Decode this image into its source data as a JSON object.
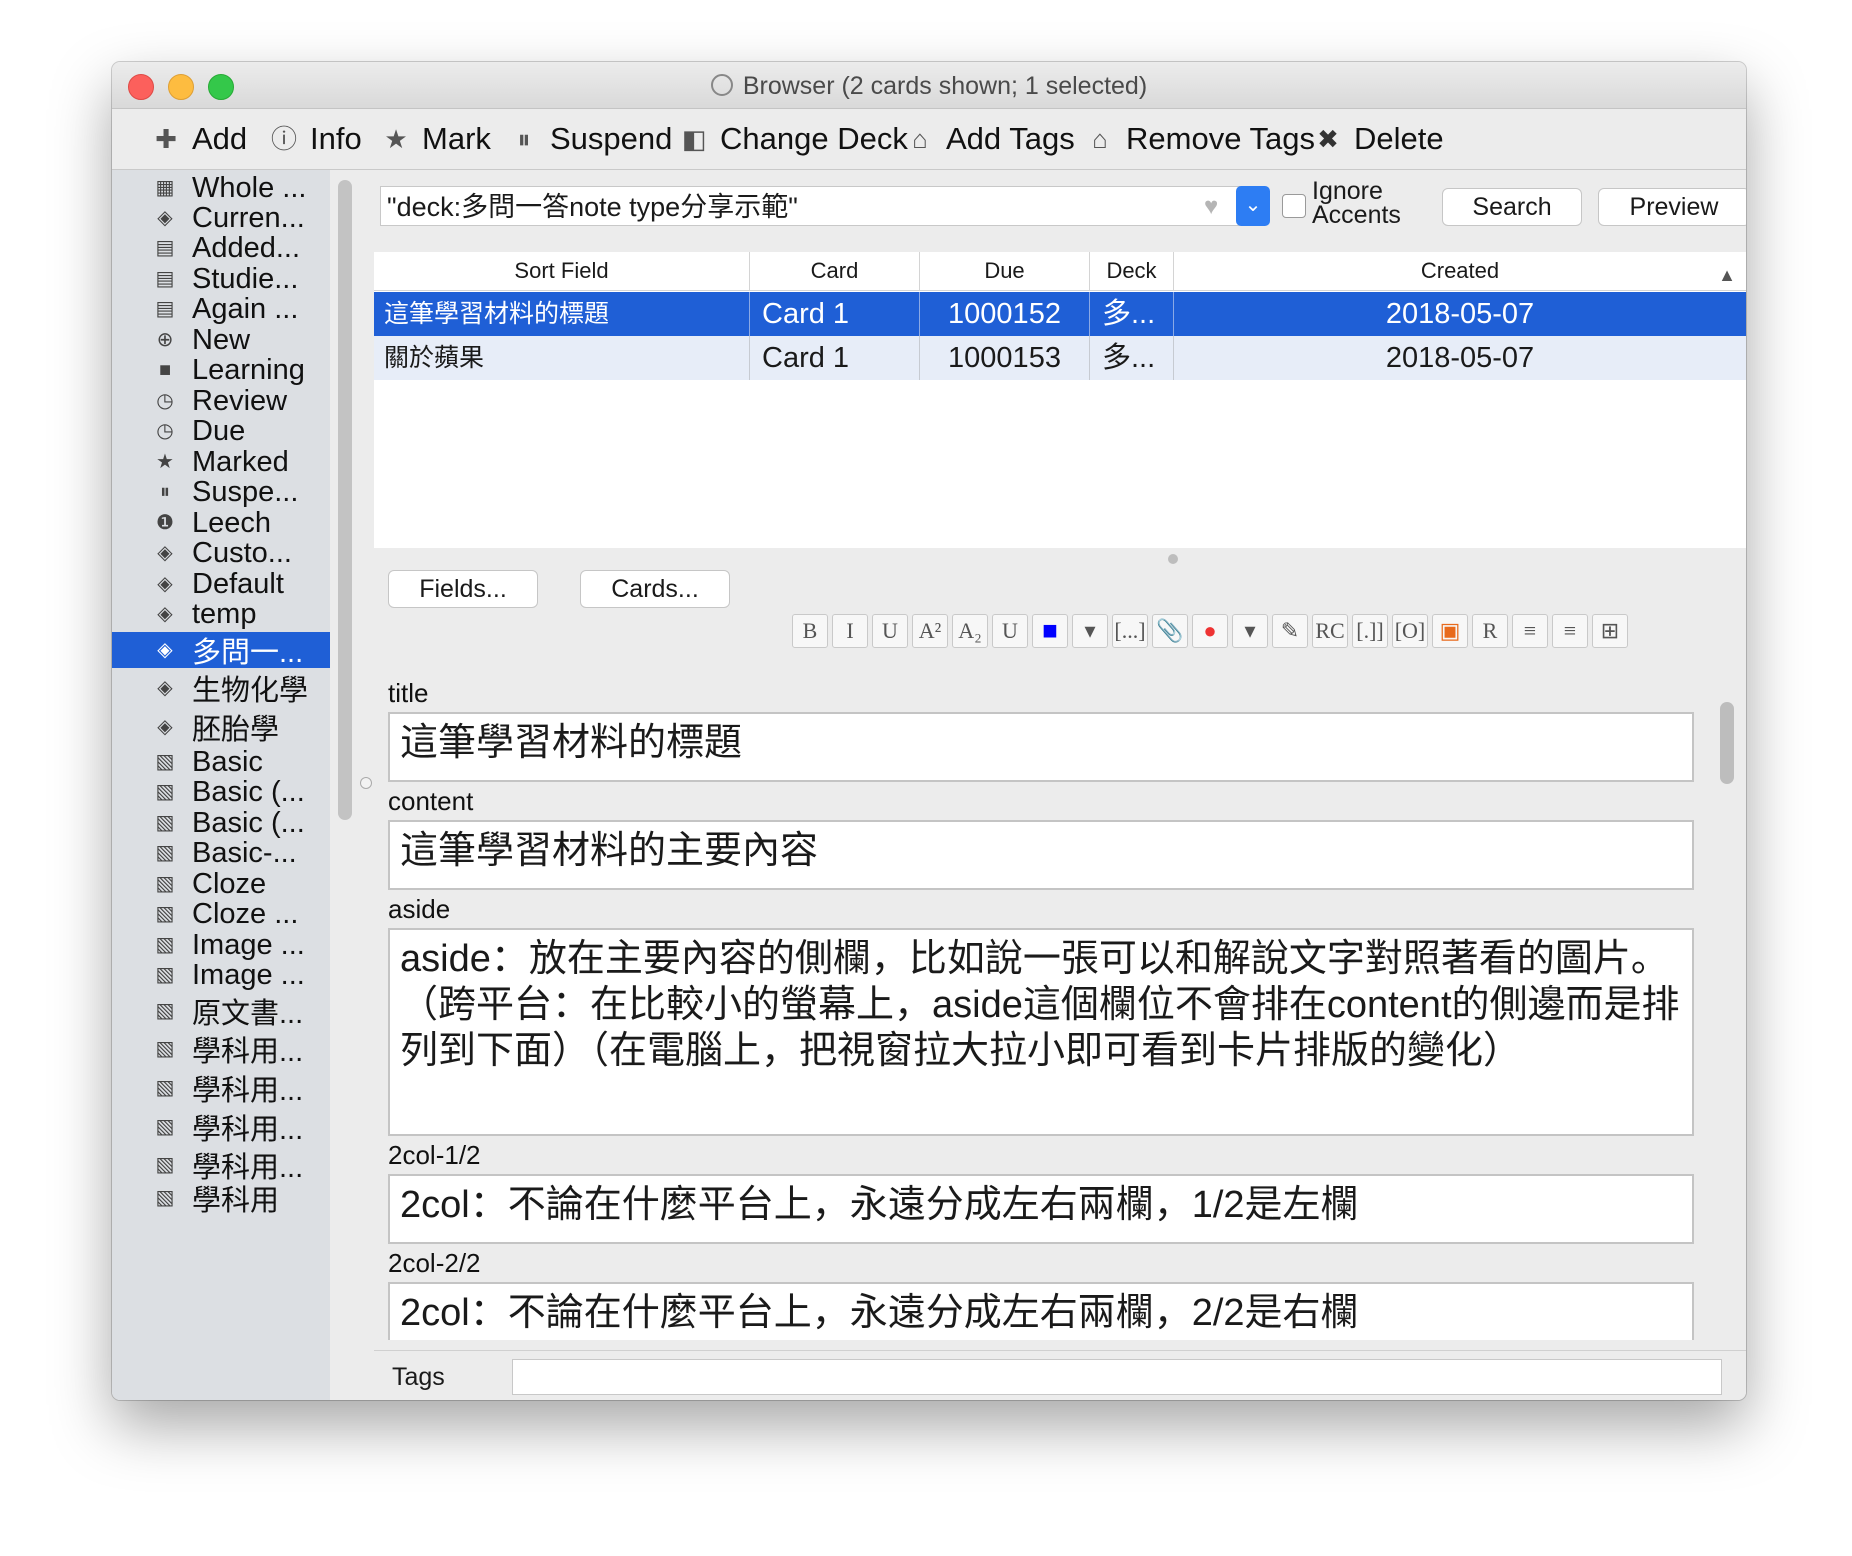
{
  "window": {
    "title": "Browser (2 cards shown; 1 selected)"
  },
  "toolbar": {
    "add": "Add",
    "info": "Info",
    "mark": "Mark",
    "suspend": "Suspend",
    "change_deck": "Change Deck",
    "add_tags": "Add Tags",
    "remove_tags": "Remove Tags",
    "delete": "Delete"
  },
  "sidebar": {
    "items": [
      {
        "label": "Whole ...",
        "icon": "collection-icon"
      },
      {
        "label": "Curren...",
        "icon": "deck-icon"
      },
      {
        "label": "Added...",
        "icon": "calendar-icon"
      },
      {
        "label": "Studie...",
        "icon": "calendar-icon"
      },
      {
        "label": "Again ...",
        "icon": "calendar-icon"
      },
      {
        "label": "New",
        "icon": "plus-circle-icon"
      },
      {
        "label": "Learning",
        "icon": "book-icon"
      },
      {
        "label": "Review",
        "icon": "clock-icon"
      },
      {
        "label": "Due",
        "icon": "clock-icon"
      },
      {
        "label": "Marked",
        "icon": "star-icon"
      },
      {
        "label": "Suspe...",
        "icon": "pause-icon"
      },
      {
        "label": "Leech",
        "icon": "warning-icon"
      },
      {
        "label": "Custo...",
        "icon": "deck-icon"
      },
      {
        "label": "Default",
        "icon": "deck-icon"
      },
      {
        "label": "temp",
        "icon": "deck-icon"
      },
      {
        "label": "多問一...",
        "icon": "deck-icon"
      },
      {
        "label": "生物化學",
        "icon": "deck-icon"
      },
      {
        "label": "胚胎學",
        "icon": "deck-icon"
      },
      {
        "label": "Basic",
        "icon": "note-type-icon"
      },
      {
        "label": "Basic (...",
        "icon": "note-type-icon"
      },
      {
        "label": "Basic (...",
        "icon": "note-type-icon"
      },
      {
        "label": "Basic-...",
        "icon": "note-type-icon"
      },
      {
        "label": "Cloze",
        "icon": "note-type-icon"
      },
      {
        "label": "Cloze ...",
        "icon": "note-type-icon"
      },
      {
        "label": "Image ...",
        "icon": "note-type-icon"
      },
      {
        "label": "Image ...",
        "icon": "note-type-icon"
      },
      {
        "label": "原文書...",
        "icon": "note-type-icon"
      },
      {
        "label": "學科用...",
        "icon": "note-type-icon"
      },
      {
        "label": "學科用...",
        "icon": "note-type-icon"
      },
      {
        "label": "學科用...",
        "icon": "note-type-icon"
      },
      {
        "label": "學科用...",
        "icon": "note-type-icon"
      },
      {
        "label": "學科用",
        "icon": "note-type-icon"
      }
    ],
    "selected_index": 15
  },
  "search": {
    "query": "\"deck:多問一答note type分享示範\"",
    "ignore_accents": "Ignore Accents",
    "search_button": "Search",
    "preview_button": "Preview"
  },
  "table": {
    "columns": [
      "Sort Field",
      "Card",
      "Due",
      "Deck",
      "Created"
    ],
    "rows": [
      {
        "sort_field": "這筆學習材料的標題",
        "card": "Card 1",
        "due": "1000152",
        "deck": "多...",
        "created": "2018-05-07"
      },
      {
        "sort_field": "關於蘋果",
        "card": "Card 1",
        "due": "1000153",
        "deck": "多...",
        "created": "2018-05-07"
      }
    ]
  },
  "editor": {
    "fields_button": "Fields...",
    "cards_button": "Cards...",
    "format_buttons": [
      "B",
      "I",
      "U",
      "A²",
      "A₂",
      "U",
      "■",
      "▾",
      "[...]",
      "📎",
      "●",
      "▾",
      "✎",
      "RC",
      "[.]]",
      "[O]",
      "▣",
      "R",
      "≡",
      "≡",
      "⊞"
    ],
    "color_accent": "#0000ff",
    "fields": [
      {
        "label": "title",
        "value": "這筆學習材料的標題"
      },
      {
        "label": "content",
        "value": "這筆學習材料的主要內容"
      },
      {
        "label": "aside",
        "value": "aside：放在主要內容的側欄，比如說一張可以和解說文字對照著看的圖片。\n（跨平台：在比較小的螢幕上，aside這個欄位不會排在content的側邊而是排列到下面）（在電腦上，把視窗拉大拉小即可看到卡片排版的變化）"
      },
      {
        "label": "2col-1/2",
        "value": "2col：不論在什麼平台上，永遠分成左右兩欄，1/2是左欄"
      },
      {
        "label": "2col-2/2",
        "value": "2col：不論在什麼平台上，永遠分成左右兩欄，2/2是右欄"
      }
    ],
    "tags_label": "Tags",
    "tags_value": ""
  }
}
